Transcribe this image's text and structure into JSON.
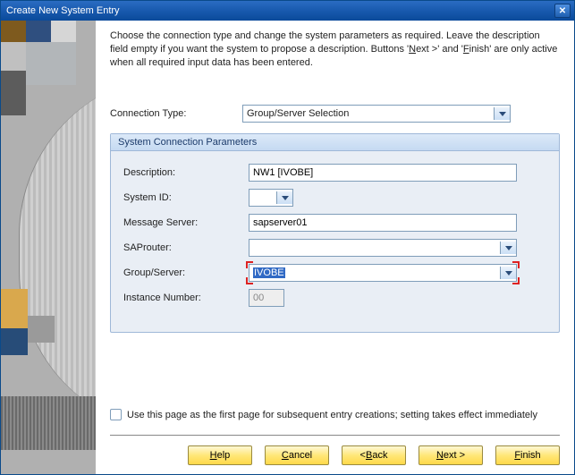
{
  "title": "Create New System Entry",
  "intro_a": "Choose the connection type and change the system parameters as required. Leave the description field empty if you want the system to propose a description. Buttons '",
  "intro_next_u": "N",
  "intro_next_rest": "ext >",
  "intro_b": "' and '",
  "intro_finish_u": "F",
  "intro_finish_rest": "inish",
  "intro_c": "' are only active when all required input data has been entered.",
  "connection_type_label": "Connection Type:",
  "connection_type_value": "Group/Server Selection",
  "groupbox_title": "System Connection Parameters",
  "fields": {
    "description_label": "Description:",
    "description_value": "NW1 [IVOBE]",
    "system_id_label": "System ID:",
    "system_id_value": "",
    "message_server_label": "Message Server:",
    "message_server_value": "sapserver01",
    "saprouter_label": "SAProuter:",
    "saprouter_value": "",
    "group_server_label": "Group/Server:",
    "group_server_value": "IVOBE",
    "instance_number_label": "Instance Number:",
    "instance_number_value": "00"
  },
  "checkbox_label": "Use this page as the first page for subsequent entry creations; setting takes effect immediately",
  "buttons": {
    "help_u": "H",
    "help_rest": "elp",
    "cancel_u": "C",
    "cancel_rest": "ancel",
    "back_pre": "< ",
    "back_u": "B",
    "back_rest": "ack",
    "next_u": "N",
    "next_rest": "ext >",
    "finish_u": "F",
    "finish_rest": "inish"
  }
}
